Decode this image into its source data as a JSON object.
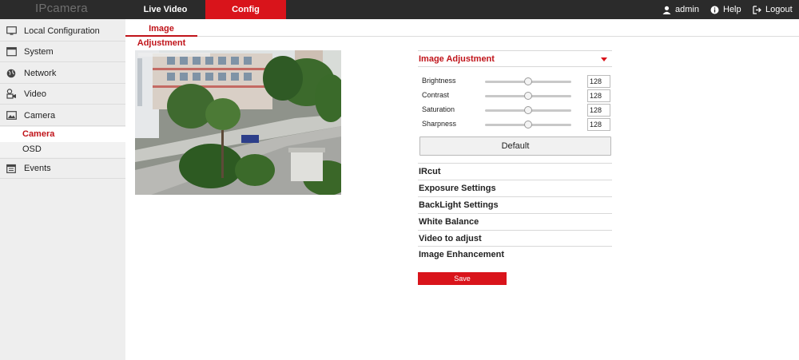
{
  "header": {
    "brand": "IPcamera",
    "tabs": [
      {
        "label": "Live Video"
      },
      {
        "label": "Config"
      }
    ],
    "user": "admin",
    "help": "Help",
    "logout": "Logout"
  },
  "sidebar": {
    "items": [
      {
        "label": "Local Configuration",
        "icon": "monitor-icon"
      },
      {
        "label": "System",
        "icon": "system-icon"
      },
      {
        "label": "Network",
        "icon": "globe-icon"
      },
      {
        "label": "Video",
        "icon": "video-icon"
      },
      {
        "label": "Camera",
        "icon": "image-icon"
      },
      {
        "label": "Events",
        "icon": "calendar-icon"
      }
    ],
    "subitems": [
      {
        "label": "Camera",
        "active": true
      },
      {
        "label": "OSD",
        "active": false
      }
    ]
  },
  "page": {
    "tab": "Image Adjustment"
  },
  "panel": {
    "active_section": "Image Adjustment",
    "sliders": [
      {
        "label": "Brightness",
        "value": "128",
        "fraction": 0.5
      },
      {
        "label": "Contrast",
        "value": "128",
        "fraction": 0.5
      },
      {
        "label": "Saturation",
        "value": "128",
        "fraction": 0.5
      },
      {
        "label": "Sharpness",
        "value": "128",
        "fraction": 0.5
      }
    ],
    "default_label": "Default",
    "sections": [
      "IRcut",
      "Exposure Settings",
      "BackLight Settings",
      "White Balance",
      "Video to adjust",
      "Image Enhancement"
    ],
    "save_label": "Save"
  },
  "colors": {
    "accent": "#d9141b",
    "topbar": "#2b2b2b",
    "sidebar": "#eeeeee"
  }
}
